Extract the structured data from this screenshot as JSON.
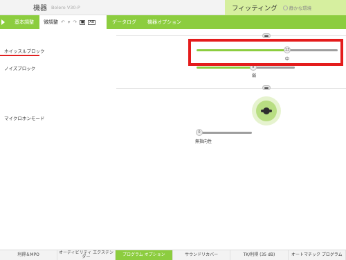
{
  "titlebar": {
    "title": "機器",
    "device": "Bolero V30-P",
    "fitting": "フィッティング",
    "environment": "静かな環境",
    "env_icon": "ear-circle-icon"
  },
  "tabs": [
    {
      "label": "基本調整"
    },
    {
      "label": "微調整"
    },
    {
      "label": "データログ"
    },
    {
      "label": "機器オプション"
    }
  ],
  "toolbar": {
    "undo": "↶",
    "dropdown": "▾",
    "redo": "↷",
    "snapshot": "■",
    "ab": "AB"
  },
  "rows": {
    "whistle_block": {
      "label": "ホイッスルブロック",
      "value": 13,
      "setting": "中",
      "max": 17
    },
    "noise_block": {
      "label": "ノイズブロック",
      "value": 8,
      "setting": "弱",
      "max": 17
    },
    "mic_mode": {
      "label": "マイクロホンモード",
      "value": 0,
      "setting": "無指向性"
    }
  },
  "colors": {
    "accent_green": "#8ccd3f",
    "highlight_red": "#e41c1c"
  },
  "programs": [
    {
      "label": "利得＆MPO",
      "active": false
    },
    {
      "label": "オーディビリティ\nエクステンダー",
      "active": false
    },
    {
      "label": "プログラム\nオプション",
      "active": true
    },
    {
      "label": "サウンドリカバー",
      "active": false
    },
    {
      "label": "TK/利得 (35 dB)",
      "active": false
    },
    {
      "label": "オートマチック\nプログラム",
      "active": false
    }
  ]
}
